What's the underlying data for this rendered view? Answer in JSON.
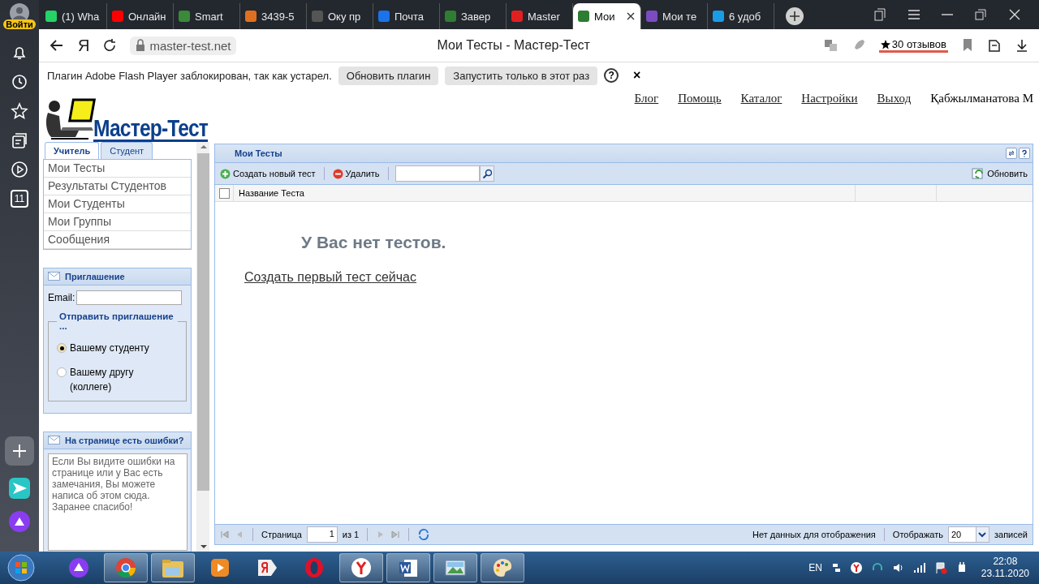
{
  "browser": {
    "profile_label": "Войти",
    "sidebar_badge": "11",
    "tabs": [
      {
        "label": "(1) Wha",
        "color": "#25d366",
        "selected": false
      },
      {
        "label": "Онлайн",
        "color": "#ff0000",
        "selected": false
      },
      {
        "label": "Smart",
        "color": "#3a8a3a",
        "selected": false
      },
      {
        "label": "3439-5",
        "color": "#e07020",
        "selected": false
      },
      {
        "label": "Оку пр",
        "color": "#555555",
        "selected": false
      },
      {
        "label": "Почта",
        "color": "#1a73e8",
        "selected": false
      },
      {
        "label": "Завер",
        "color": "#2e7d32",
        "selected": false
      },
      {
        "label": "Master",
        "color": "#e02020",
        "selected": false
      },
      {
        "label": "Мои",
        "color": "#2e7d32",
        "selected": true
      },
      {
        "label": "Мои те",
        "color": "#7a4cc0",
        "selected": false
      },
      {
        "label": "6 удоб",
        "color": "#1a9be6",
        "selected": false
      }
    ],
    "yandex_button": "Я",
    "address": "master-test.net",
    "page_title": "Мои Тесты - Мастер-Тест",
    "reviews": "30 отзывов",
    "infobar": {
      "message": "Плагин Adobe Flash Player заблокирован, так как устарел.",
      "buttons": [
        "Обновить плагин",
        "Запустить только в этот раз"
      ],
      "help": "?",
      "close": "×"
    }
  },
  "site": {
    "logo": "Мастер-Тест",
    "nav": [
      "Блог",
      "Помощь",
      "Каталог",
      "Настройки",
      "Выход"
    ],
    "user": "Қабжылманатова М"
  },
  "sidebar": {
    "tabs": [
      {
        "label": "Учитель",
        "selected": true
      },
      {
        "label": "Студент",
        "selected": false
      }
    ],
    "menu": [
      "Мои Тесты",
      "Результаты Студентов",
      "Мои Студенты",
      "Мои Группы",
      "Сообщения"
    ]
  },
  "invite": {
    "title": "Приглашение",
    "email_label": "Email:",
    "group_title": "Отправить приглашение ...",
    "options": [
      {
        "label": "Вашему студенту",
        "selected": true
      },
      {
        "label": "Вашему другу (коллеге)",
        "selected": false
      }
    ]
  },
  "feedback": {
    "title": "На странице есть ошибки?",
    "placeholder": "Если Вы видите ошибки на странице или у Вас есть замечания, Вы можете написа об этом сюда.\nЗаранее спасибо!"
  },
  "panel": {
    "title": "Мои Тесты",
    "create": "Создать новый тест",
    "delete": "Удалить",
    "refresh": "Обновить",
    "select_all_checked": false,
    "columns": [
      "Название Теста"
    ],
    "empty_title": "У Вас нет тестов.",
    "empty_link": "Создать первый тест сейчас",
    "pager": {
      "page_label": "Страница",
      "page": "1",
      "of": "из 1",
      "status": "Нет данных для отображения",
      "show_label": "Отображать",
      "page_size": "20",
      "records": "записей"
    }
  },
  "taskbar": {
    "apps": [
      {
        "kind": "assistant",
        "running": false
      },
      {
        "kind": "chrome",
        "running": true
      },
      {
        "kind": "folder",
        "running": true
      },
      {
        "kind": "media",
        "running": false
      },
      {
        "kind": "yandex-letter",
        "running": false
      },
      {
        "kind": "opera",
        "running": false
      },
      {
        "kind": "yandex",
        "running": true
      },
      {
        "kind": "word",
        "running": true
      },
      {
        "kind": "picture",
        "running": true
      },
      {
        "kind": "paint",
        "running": true
      }
    ],
    "language": "EN",
    "time": "22:08",
    "date": "23.11.2020"
  }
}
